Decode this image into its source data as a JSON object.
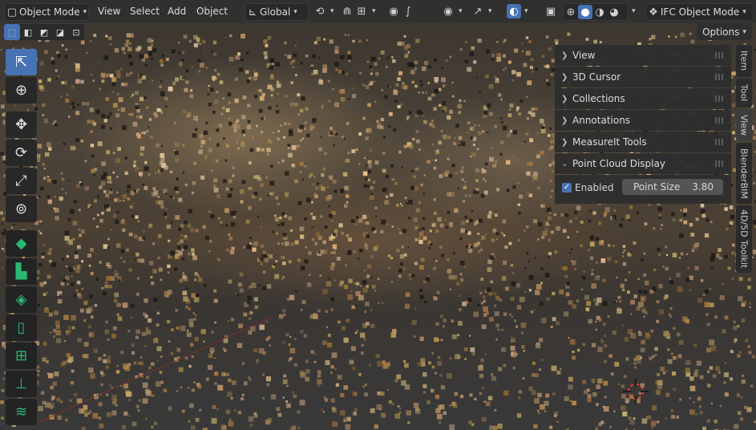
{
  "header": {
    "mode": "Object Mode",
    "menus": [
      "View",
      "Select",
      "Add",
      "Object"
    ],
    "orientation": "Global",
    "ifc_mode": "IFC Object Mode"
  },
  "options_label": "Options",
  "sidebar": {
    "sections": [
      {
        "label": "View",
        "expanded": false
      },
      {
        "label": "3D Cursor",
        "expanded": false
      },
      {
        "label": "Collections",
        "expanded": false
      },
      {
        "label": "Annotations",
        "expanded": false
      },
      {
        "label": "MeasureIt Tools",
        "expanded": false
      },
      {
        "label": "Point Cloud Display",
        "expanded": true
      }
    ],
    "point_cloud": {
      "enabled_label": "Enabled",
      "enabled": true,
      "point_size_label": "Point Size",
      "point_size_value": "3.80"
    },
    "tabs": [
      "Item",
      "Tool",
      "View",
      "BlenderBIM",
      "4D/5D Toolkit"
    ],
    "active_tab": "View"
  },
  "colors": {
    "accent": "#4772b3",
    "bim_green": "#2bb673",
    "header_bg": "#303030"
  },
  "toolbar_icons": [
    "select-box-icon",
    "cursor-icon",
    "move-icon",
    "rotate-icon",
    "scale-icon",
    "transform-icon",
    "explore-icon",
    "wall-icon",
    "slab-icon",
    "door-icon",
    "window-icon",
    "column-icon",
    "stack-icon"
  ]
}
